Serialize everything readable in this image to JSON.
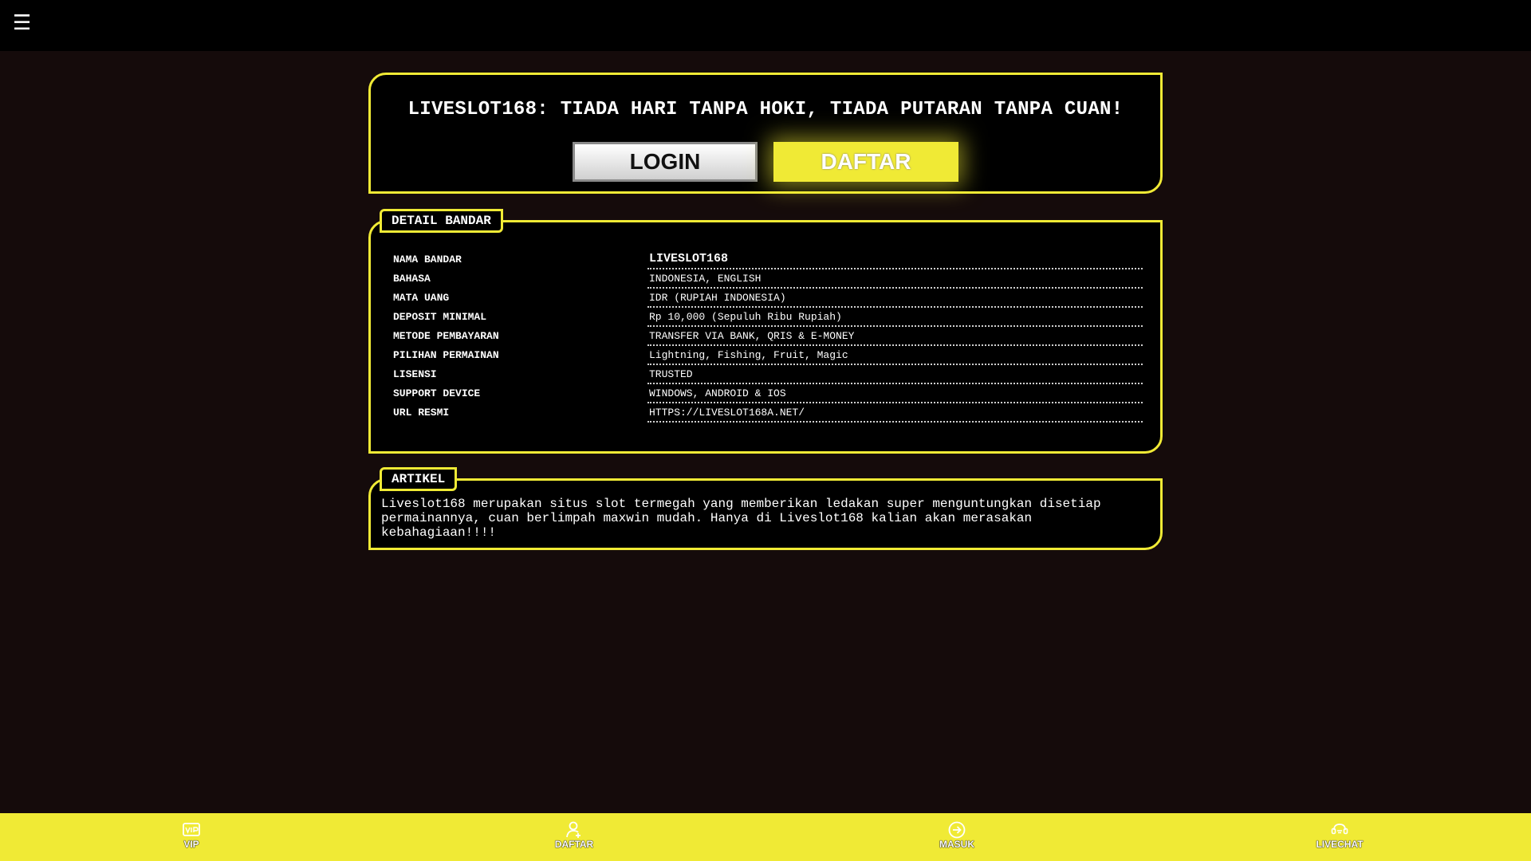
{
  "header": {
    "menu_icon": "hamburger-icon"
  },
  "hero": {
    "title": "LIVESLOT168: TIADA HARI TANPA HOKI, TIADA PUTARAN TANPA CUAN!",
    "login_label": "LOGIN",
    "daftar_label": "DAFTAR"
  },
  "detail": {
    "legend": "DETAIL BANDAR",
    "rows": [
      {
        "key": "NAMA BANDAR",
        "value": "LIVESLOT168"
      },
      {
        "key": "BAHASA",
        "value": "INDONESIA, ENGLISH"
      },
      {
        "key": "MATA UANG",
        "value": "IDR (RUPIAH INDONESIA)"
      },
      {
        "key": "DEPOSIT MINIMAL",
        "value": "Rp 10,000 (Sepuluh Ribu Rupiah)"
      },
      {
        "key": "METODE PEMBAYARAN",
        "value": "TRANSFER VIA BANK, QRIS & E-MONEY"
      },
      {
        "key": "PILIHAN PERMAINAN",
        "value": "Lightning, Fishing, Fruit, Magic"
      },
      {
        "key": "LISENSI",
        "value": "TRUSTED"
      },
      {
        "key": "SUPPORT DEVICE",
        "value": "WINDOWS, ANDROID & IOS"
      },
      {
        "key": "URL RESMI",
        "value": "HTTPS://LIVESLOT168A.NET/"
      }
    ]
  },
  "artikel": {
    "legend": "ARTIKEL",
    "text": "Liveslot168 merupakan situs slot termegah yang memberikan ledakan super menguntungkan disetiap permainannya, cuan berlimpah maxwin mudah. Hanya di Liveslot168 kalian akan merasakan kebahagiaan!!!!"
  },
  "bottom_nav": [
    {
      "label": "VIP",
      "icon": "vip-icon"
    },
    {
      "label": "DAFTAR",
      "icon": "user-add-icon"
    },
    {
      "label": "MASUK",
      "icon": "login-arrow-icon"
    },
    {
      "label": "LIVECHAT",
      "icon": "chat-icon"
    }
  ],
  "colors": {
    "accent": "#f0ea35",
    "background": "#150b0b",
    "panel": "#000000"
  }
}
